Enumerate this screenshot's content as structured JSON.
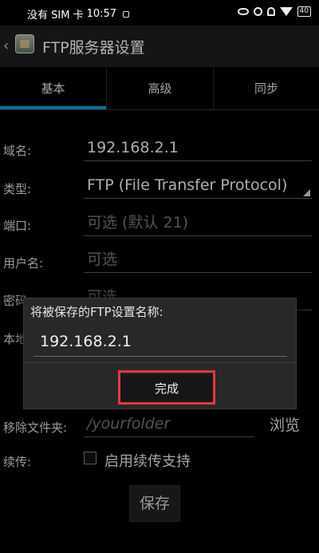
{
  "status_bar": {
    "carrier": "没有 SIM 卡",
    "time": "10:57",
    "battery": "40"
  },
  "header": {
    "title": "FTP服务器设置"
  },
  "tabs": [
    {
      "label": "基本",
      "active": true
    },
    {
      "label": "高级",
      "active": false
    },
    {
      "label": "同步",
      "active": false
    }
  ],
  "form": {
    "domain": {
      "label": "域名:",
      "value": "192.168.2.1"
    },
    "type": {
      "label": "类型:",
      "value": "FTP (File Transfer Protocol)"
    },
    "port": {
      "label": "端口:",
      "placeholder": "可选 (默认 21)"
    },
    "username": {
      "label": "用户名:",
      "placeholder": "可选"
    },
    "password": {
      "label": "密码",
      "placeholder": "可选"
    },
    "local": {
      "label": "本地"
    },
    "remote_folder": {
      "label": "移除文件夹:",
      "placeholder": "/yourfolder",
      "browse_label": "浏览"
    },
    "resume": {
      "label": "续传:",
      "checkbox_label": "启用续传支持",
      "checked": false
    },
    "save_label": "保存"
  },
  "dialog": {
    "title": "将被保存的FTP设置名称:",
    "input_value": "192.168.2.1",
    "done_label": "完成"
  },
  "colors": {
    "accent": "#1a8fc6",
    "highlight": "#e5383b"
  }
}
